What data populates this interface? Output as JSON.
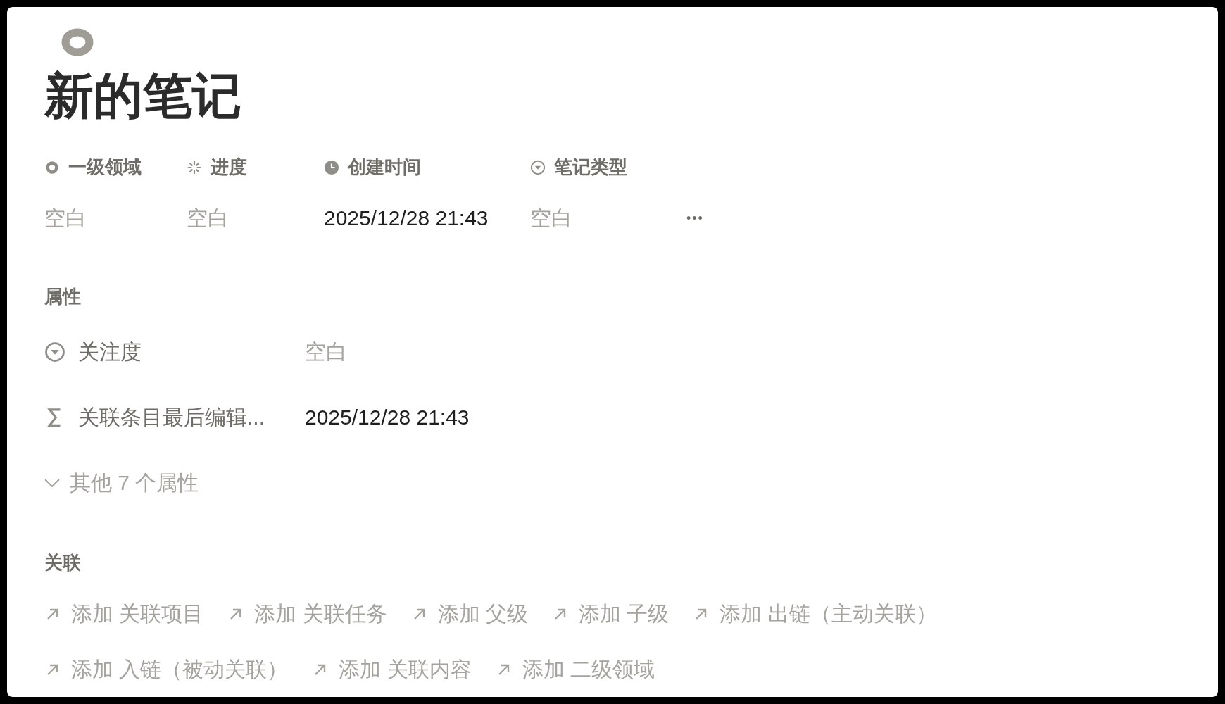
{
  "page": {
    "title": "新的笔记"
  },
  "top_properties": [
    {
      "kind": "ring",
      "name": "一级领域",
      "placeholder": "空白"
    },
    {
      "kind": "status",
      "name": "进度",
      "placeholder": "空白"
    },
    {
      "kind": "created_time",
      "name": "创建时间",
      "value": "2025/12/28 21:43"
    },
    {
      "kind": "select",
      "name": "笔记类型",
      "placeholder": "空白"
    }
  ],
  "more_button": "•••",
  "properties": {
    "heading": "属性",
    "rows": [
      {
        "kind": "select",
        "name": "关注度",
        "placeholder": "空白"
      },
      {
        "kind": "formula",
        "name": "关联条目最后编辑...",
        "value": "2025/12/28 21:43"
      }
    ],
    "expander": {
      "label": "其他 7 个属性",
      "expanded": false
    }
  },
  "relations": {
    "heading": "关联",
    "links": [
      [
        "添加 关联项目",
        "添加 关联任务",
        "添加 父级",
        "添加 子级",
        "添加 出链（主动关联）"
      ],
      [
        "添加 入链（被动关联）",
        "添加 关联内容",
        "添加 二级领域"
      ]
    ]
  }
}
